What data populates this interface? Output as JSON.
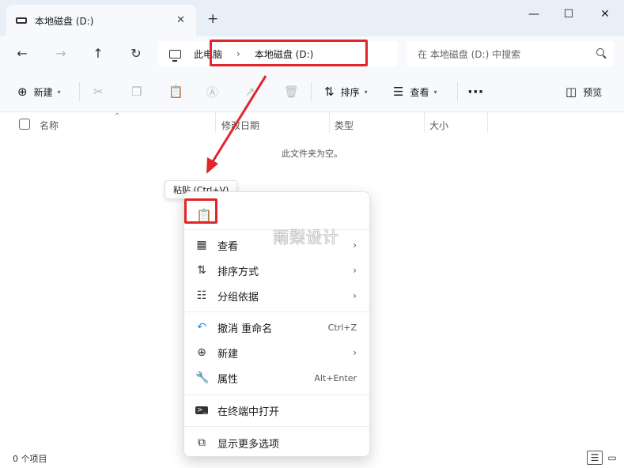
{
  "tab": {
    "title": "本地磁盘 (D:)"
  },
  "nav": {
    "breadcrumb": [
      "此电脑",
      "本地磁盘 (D:)"
    ],
    "search_placeholder": "在 本地磁盘 (D:) 中搜索"
  },
  "toolbar": {
    "new": "新建",
    "sort": "排序",
    "view": "查看",
    "preview": "预览"
  },
  "columns": [
    "名称",
    "修改日期",
    "类型",
    "大小"
  ],
  "empty_text": "此文件夹为空。",
  "status": "0 个项目",
  "tooltip": "粘贴 (Ctrl+V)",
  "watermark": "雨梨设计",
  "menu": {
    "view": "查看",
    "sort_by": "排序方式",
    "group_by": "分组依据",
    "undo_rename": "撤消 重命名",
    "undo_shortcut": "Ctrl+Z",
    "new": "新建",
    "properties": "属性",
    "properties_shortcut": "Alt+Enter",
    "open_terminal": "在终端中打开",
    "more_options": "显示更多选项"
  },
  "icons": {
    "drive": "drive-icon",
    "back": "back-arrow-icon",
    "forward": "forward-arrow-icon",
    "up": "up-arrow-icon",
    "refresh": "refresh-icon",
    "pc": "computer-icon",
    "search": "search-icon",
    "paste": "paste-icon"
  },
  "colors": {
    "highlight": "#e0262b",
    "background": "#eef3f9"
  }
}
